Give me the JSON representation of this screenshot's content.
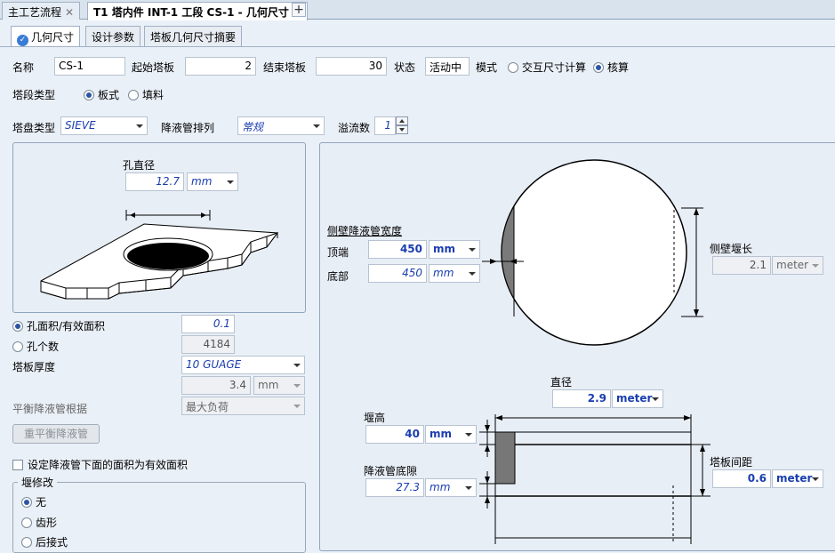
{
  "doc_tabs": [
    {
      "label": "主工艺流程",
      "active": false
    },
    {
      "label": "T1 塔内件 INT-1 工段 CS-1 - 几何尺寸",
      "active": true
    }
  ],
  "sub_tabs": [
    "几何尺寸",
    "设计参数",
    "塔板几何尺寸摘要"
  ],
  "header": {
    "name_label": "名称",
    "name_value": "CS-1",
    "start_label": "起始塔板",
    "start_value": "2",
    "end_label": "结束塔板",
    "end_value": "30",
    "status_label": "状态",
    "status_value": "活动中",
    "mode_label": "模式",
    "mode_opt1": "交互尺寸计算",
    "mode_opt2": "核算"
  },
  "section_type": {
    "label": "塔段类型",
    "opt1": "板式",
    "opt2": "填料"
  },
  "tray_row": {
    "tray_type_label": "塔盘类型",
    "tray_type_value": "SIEVE",
    "dc_arr_label": "降液管排列",
    "dc_arr_value": "常规",
    "passes_label": "溢流数",
    "passes_value": "1"
  },
  "hole_panel": {
    "hole_dia_label": "孔直径",
    "hole_dia_value": "12.7",
    "hole_dia_unit": "mm"
  },
  "left_fields": {
    "hole_area_label": "孔面积/有效面积",
    "hole_area_value": "0.1",
    "hole_count_label": "孔个数",
    "hole_count_value": "4184",
    "thickness_label": "塔板厚度",
    "thickness_value": "10 GUAGE",
    "thickness_num": "3.4",
    "thickness_unit": "mm",
    "balance_label": "平衡降液管根据",
    "balance_value": "最大负荷",
    "rebalance_button": "重平衡降液管",
    "set_area_label": "设定降液管下面的面积为有效面积",
    "weir_mod_title": "堰修改",
    "weir_opt1": "无",
    "weir_opt2": "齿形",
    "weir_opt3": "后接式"
  },
  "diagram": {
    "side_dc_width_label": "侧壁降液管宽度",
    "top_label": "顶端",
    "top_value": "450",
    "top_unit": "mm",
    "bottom_label": "底部",
    "bottom_value": "450",
    "bottom_unit": "mm",
    "side_weir_label": "侧壁堰长",
    "side_weir_value": "2.1",
    "side_weir_unit": "meter",
    "diameter_label": "直径",
    "diameter_value": "2.9",
    "diameter_unit": "meter",
    "weir_h_label": "堰高",
    "weir_h_value": "40",
    "weir_h_unit": "mm",
    "dc_clear_label": "降液管底隙",
    "dc_clear_value": "27.3",
    "dc_clear_unit": "mm",
    "spacing_label": "塔板间距",
    "spacing_value": "0.6",
    "spacing_unit": "meter"
  }
}
